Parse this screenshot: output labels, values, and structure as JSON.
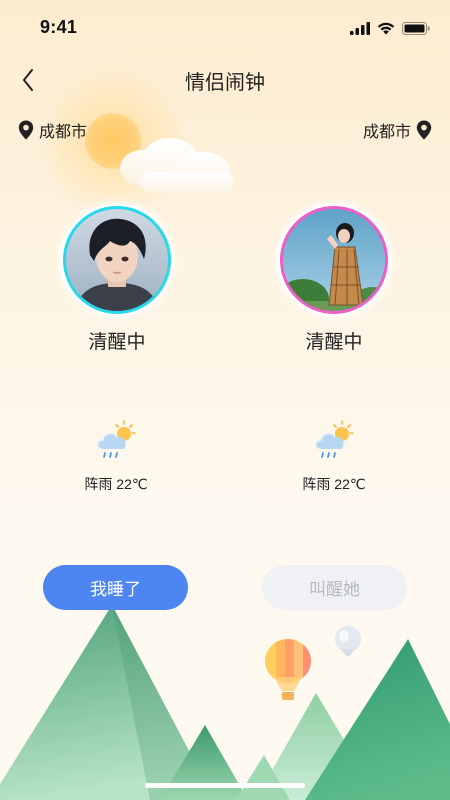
{
  "status_bar": {
    "time": "9:41"
  },
  "nav": {
    "title": "情侣闹钟"
  },
  "locations": {
    "left": "成都市",
    "right": "成都市"
  },
  "partners": [
    {
      "status": "清醒中",
      "weather": "阵雨 22℃",
      "ring_color": "#27d7ea"
    },
    {
      "status": "清醒中",
      "weather": "阵雨 22℃",
      "ring_color": "#ec5fc4"
    }
  ],
  "actions": {
    "sleep_label": "我睡了",
    "wake_label": "叫醒她"
  },
  "colors": {
    "primary": "#4d86f1",
    "disabled_bg": "#f0f1f4",
    "disabled_text": "#b7bac2",
    "mountain": "#4da57a"
  }
}
